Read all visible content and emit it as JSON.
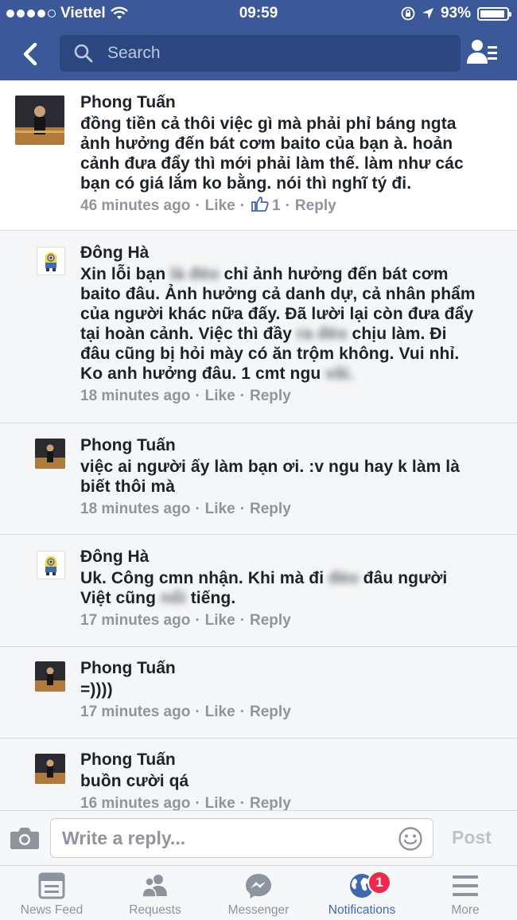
{
  "status_bar": {
    "carrier": "Viettel",
    "time": "09:59",
    "battery": "93%",
    "battery_level": 0.93
  },
  "nav": {
    "search_placeholder": "Search"
  },
  "comments": [
    {
      "name": "Phong Tuấn",
      "text": "đồng tiền cả thôi việc gì mà phải phỉ báng ngta\nảnh hưởng đến bát cơm baito của bạn à. hoản\ncảnh đưa đẩy thì mới phải làm thế. làm như các\nbạn có giá lắm ko bằng. nói thì nghĩ tý đi.",
      "time": "46 minutes ago",
      "like": "Like",
      "like_count": "1",
      "reply": "Reply"
    },
    {
      "name": "Đông Hà",
      "text_parts": [
        "Xin lỗi bạn ",
        "là đéo",
        " chỉ ảnh hưởng đến bát cơm\nbaito đâu. Ảnh hưởng cả danh dự, cả nhân phẩm\ncủa người khác nữa đấy. Đã lười lại còn đưa đẩy\ntại hoàn cảnh. Việc thì đầy ",
        "ra đéo",
        " chịu làm. Đi\nđâu cũng bị hỏi mày có ăn trộm không. Vui nhỉ.\nKo anh hưởng đâu. 1 cmt ngu ",
        "vãi."
      ],
      "time": "18 minutes ago",
      "like": "Like",
      "reply": "Reply"
    },
    {
      "name": "Phong Tuấn",
      "text": "việc ai người ấy làm bạn ơi. :v ngu hay k làm là\nbiết thôi mà",
      "time": "18 minutes ago",
      "like": "Like",
      "reply": "Reply"
    },
    {
      "name": "Đông Hà",
      "text_parts": [
        "Uk. Công cmn nhận. Khi mà đi ",
        "đéo",
        " đâu người\nViệt cũng ",
        "nổi",
        " tiếng."
      ],
      "time": "17 minutes ago",
      "like": "Like",
      "reply": "Reply"
    },
    {
      "name": "Phong Tuấn",
      "text": "=))))",
      "time": "17 minutes ago",
      "like": "Like",
      "reply": "Reply"
    },
    {
      "name": "Phong Tuấn",
      "text": "buồn cười qá",
      "time": "16 minutes ago",
      "like": "Like",
      "reply": "Reply"
    }
  ],
  "composer": {
    "placeholder": "Write a reply...",
    "post_label": "Post"
  },
  "tabs": [
    {
      "label": "News Feed",
      "icon": "news-feed-icon"
    },
    {
      "label": "Requests",
      "icon": "friend-requests-icon"
    },
    {
      "label": "Messenger",
      "icon": "messenger-icon"
    },
    {
      "label": "Notifications",
      "icon": "globe-icon",
      "active": true,
      "badge": "1"
    },
    {
      "label": "More",
      "icon": "menu-icon"
    }
  ],
  "colors": {
    "brand": "#3b5998",
    "active_tab": "#4267b2",
    "badge": "#f02849"
  }
}
